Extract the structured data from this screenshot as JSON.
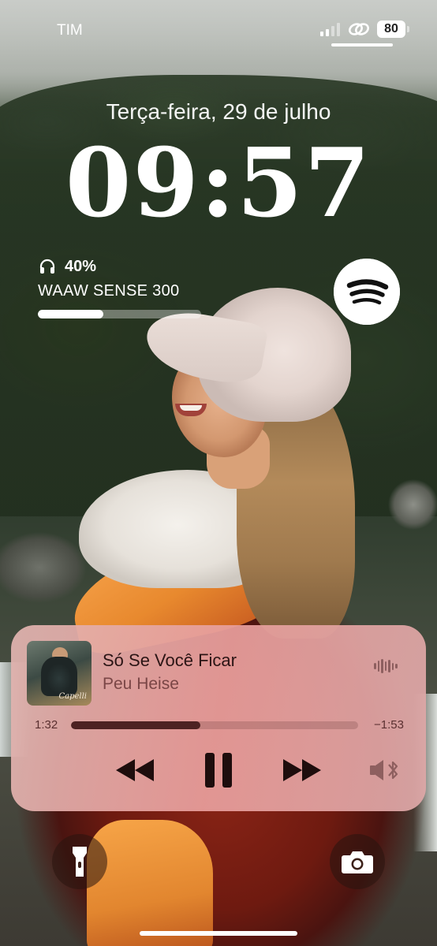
{
  "status_bar": {
    "carrier": "TIM",
    "battery_level": "80",
    "signal_bars_active": 2,
    "signal_bars_total": 4
  },
  "lock_screen": {
    "date": "Terça-feira, 29 de julho",
    "time": "09:57"
  },
  "headphones_widget": {
    "icon": "headphones-icon",
    "battery_percent": "40%",
    "battery_level": 0.4,
    "device_name": "WAAW SENSE 300"
  },
  "spotify_widget": {
    "icon": "spotify-icon"
  },
  "now_playing": {
    "title": "Só Se Você Ficar",
    "artist": "Peu Heise",
    "album_art_signature": "Capelli",
    "elapsed": "1:32",
    "remaining": "−1:53",
    "progress": 0.45,
    "controls": [
      "rewind-icon",
      "pause-icon",
      "fast-forward-icon"
    ],
    "output_icon": "speaker-bluetooth-icon"
  },
  "quick_actions": {
    "left": "flashlight-icon",
    "right": "camera-icon"
  },
  "colors": {
    "player_tint": "#e8a09c",
    "player_text": "#2b1515",
    "progress_fill": "#4d2222"
  }
}
